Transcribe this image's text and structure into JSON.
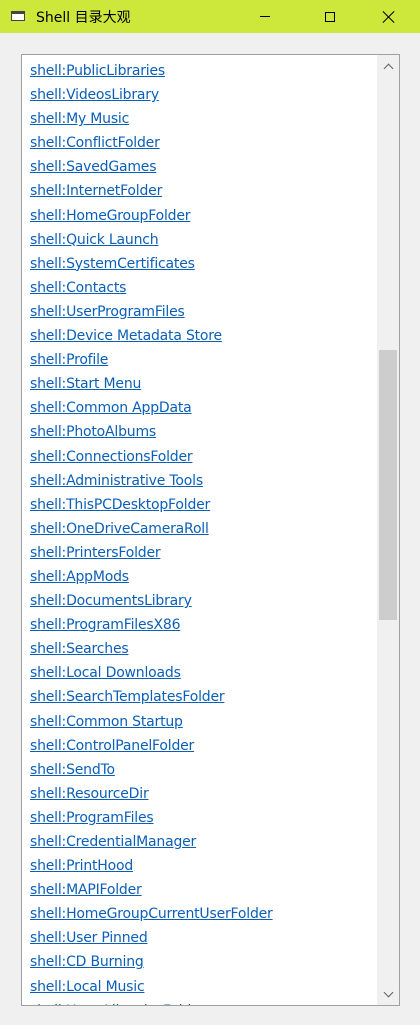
{
  "window": {
    "title": "Shell 目录大观"
  },
  "list": {
    "items": [
      "shell:PublicLibraries",
      "shell:VideosLibrary",
      "shell:My Music",
      "shell:ConflictFolder",
      "shell:SavedGames",
      "shell:InternetFolder",
      "shell:HomeGroupFolder",
      "shell:Quick Launch",
      "shell:SystemCertificates",
      "shell:Contacts",
      "shell:UserProgramFiles",
      "shell:Device Metadata Store",
      "shell:Profile",
      "shell:Start Menu",
      "shell:Common AppData",
      "shell:PhotoAlbums",
      "shell:ConnectionsFolder",
      "shell:Administrative Tools",
      "shell:ThisPCDesktopFolder",
      "shell:OneDriveCameraRoll",
      "shell:PrintersFolder",
      "shell:AppMods",
      "shell:DocumentsLibrary",
      "shell:ProgramFilesX86",
      "shell:Searches",
      "shell:Local Downloads",
      "shell:SearchTemplatesFolder",
      "shell:Common Startup",
      "shell:ControlPanelFolder",
      "shell:SendTo",
      "shell:ResourceDir",
      "shell:ProgramFiles",
      "shell:CredentialManager",
      "shell:PrintHood",
      "shell:MAPIFolder",
      "shell:HomeGroupCurrentUserFolder",
      "shell:User Pinned",
      "shell:CD Burning",
      "shell:Local Music",
      "shell:UsersLibrariesFolder"
    ]
  },
  "colors": {
    "titlebar": "#cde83a",
    "link": "#0b5fb8"
  },
  "icons": {
    "app": "window-app-icon",
    "minimize": "minimize-icon",
    "maximize": "maximize-icon",
    "close": "close-icon"
  }
}
